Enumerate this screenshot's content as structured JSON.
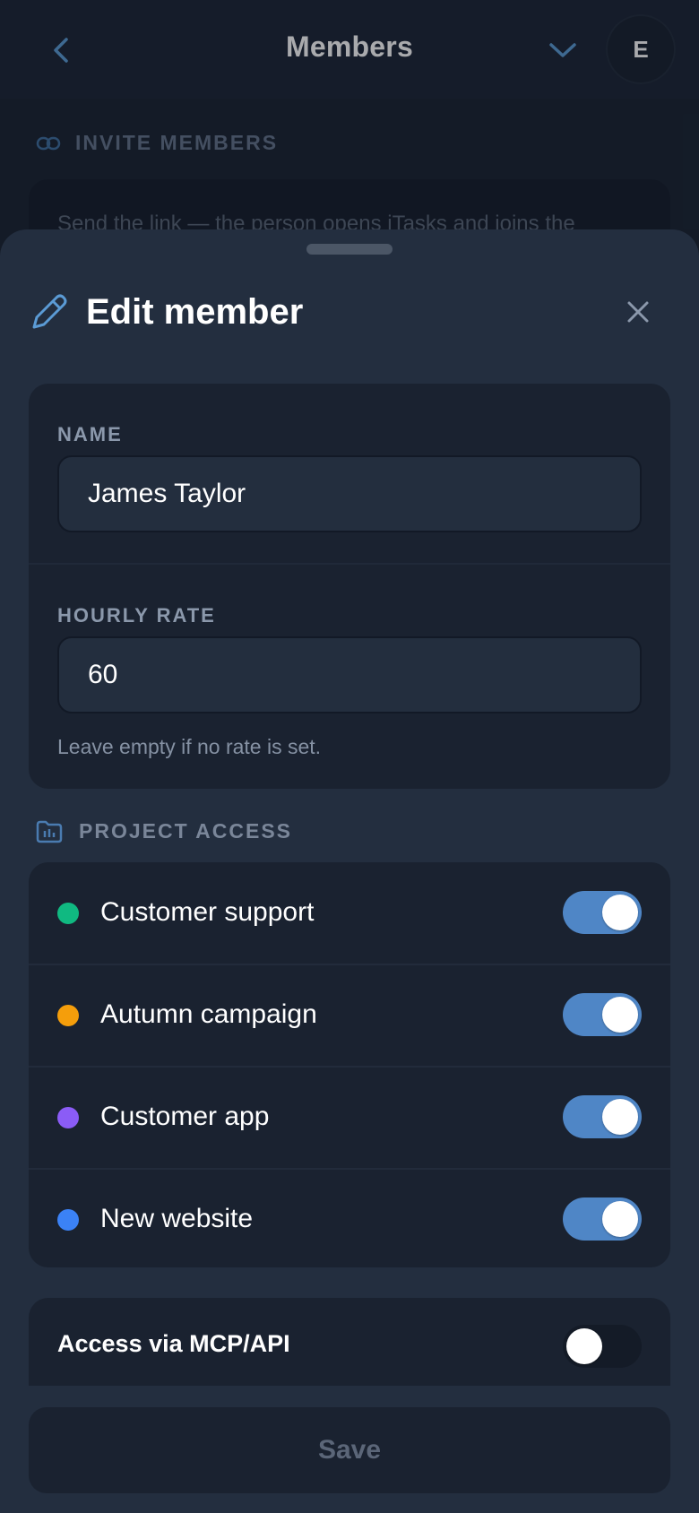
{
  "topbar": {
    "title": "Members",
    "avatar_initial": "E"
  },
  "background": {
    "invite_section_label": "INVITE MEMBERS",
    "invite_text": "Send the link — the person opens iTasks and joins the"
  },
  "sheet": {
    "title": "Edit member",
    "fields": {
      "name_label": "NAME",
      "name_value": "James Taylor",
      "rate_label": "HOURLY RATE",
      "rate_value": "60",
      "rate_hint": "Leave empty if no rate is set."
    },
    "project_access_label": "PROJECT ACCESS",
    "projects": [
      {
        "name": "Customer support",
        "color": "#10b981",
        "enabled": true
      },
      {
        "name": "Autumn campaign",
        "color": "#f59e0b",
        "enabled": true
      },
      {
        "name": "Customer app",
        "color": "#8b5cf6",
        "enabled": true
      },
      {
        "name": "New website",
        "color": "#3b82f6",
        "enabled": true
      }
    ],
    "mcp": {
      "label": "Access via MCP/API",
      "enabled": false
    },
    "save_label": "Save"
  },
  "colors": {
    "accent": "#4f86c6",
    "icon_blue": "#5b9bd5",
    "background": "#1b2432",
    "sheet": "#232e3f",
    "card": "#1a2230"
  }
}
